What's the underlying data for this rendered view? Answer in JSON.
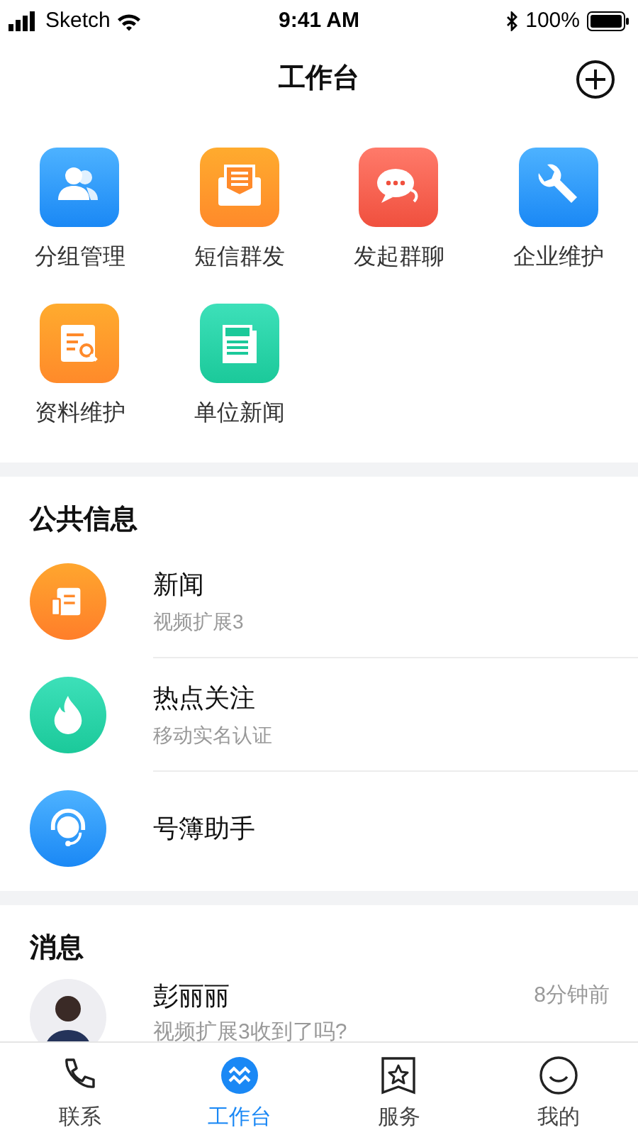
{
  "status_bar": {
    "carrier": "Sketch",
    "time": "9:41 AM",
    "battery": "100%"
  },
  "header": {
    "title": "工作台"
  },
  "apps": [
    {
      "label": "分组管理",
      "kind": "group"
    },
    {
      "label": "短信群发",
      "kind": "sms"
    },
    {
      "label": "发起群聊",
      "kind": "chat"
    },
    {
      "label": "企业维护",
      "kind": "wrench"
    },
    {
      "label": "资料维护",
      "kind": "doc"
    },
    {
      "label": "单位新闻",
      "kind": "news"
    }
  ],
  "public_info": {
    "title": "公共信息",
    "items": [
      {
        "title": "新闻",
        "subtitle": "视频扩展3",
        "kind": "news"
      },
      {
        "title": "热点关注",
        "subtitle": "移动实名认证",
        "kind": "fire"
      },
      {
        "title": "号簿助手",
        "kind": "support"
      }
    ]
  },
  "messages": {
    "title": "消息",
    "items": [
      {
        "name": "彭丽丽",
        "preview": "视频扩展3收到了吗?",
        "time": "8分钟前"
      }
    ]
  },
  "tabs": [
    {
      "label": "联系",
      "kind": "phone",
      "selected": false
    },
    {
      "label": "工作台",
      "kind": "work",
      "selected": true
    },
    {
      "label": "服务",
      "kind": "service",
      "selected": false
    },
    {
      "label": "我的",
      "kind": "me",
      "selected": false
    }
  ]
}
